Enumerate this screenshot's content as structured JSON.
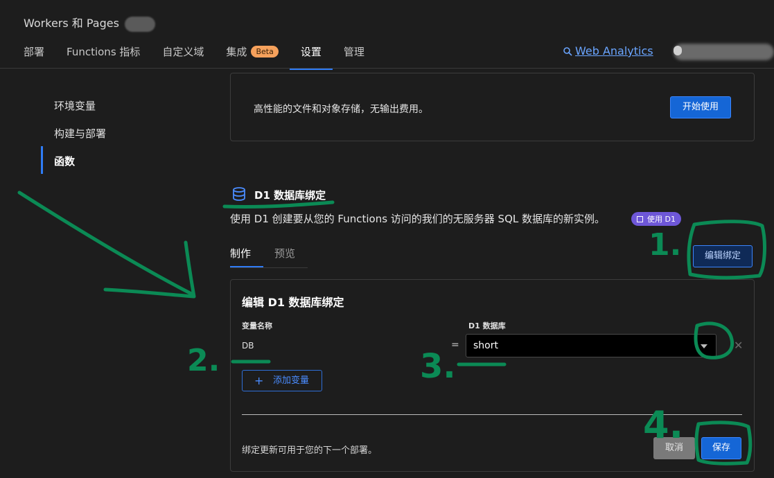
{
  "header": {
    "app_title": "Workers 和 Pages",
    "tabs": [
      {
        "label": "部署"
      },
      {
        "label": "Functions 指标"
      },
      {
        "label": "自定义域"
      },
      {
        "label": "集成",
        "badge": "Beta"
      },
      {
        "label": "设置",
        "active": true
      },
      {
        "label": "管理"
      }
    ],
    "analytics_link": "Web Analytics"
  },
  "sidebar": {
    "items": [
      {
        "label": "环境变量"
      },
      {
        "label": "构建与部署"
      },
      {
        "label": "函数",
        "active": true
      }
    ]
  },
  "storage_card": {
    "text": "高性能的文件和对象存储，无输出费用。",
    "button": "开始使用"
  },
  "d1": {
    "title": "D1 数据库绑定",
    "description": "使用 D1 创建要从您的 Functions 访问的我们的无服务器 SQL 数据库的新实例。",
    "badge": "使用 D1",
    "subtabs": [
      "制作",
      "预览"
    ],
    "edit_button": "编辑绑定"
  },
  "edit_card": {
    "title": "编辑 D1 数据库绑定",
    "col_var": "变量名称",
    "col_db": "D1 数据库",
    "var_value": "DB",
    "equals": "=",
    "db_value": "short",
    "clear": "✕",
    "add_button": "添加变量",
    "add_plus": "+",
    "footnote": "绑定更新可用于您的下一个部署。",
    "cancel": "取消",
    "save": "保存"
  },
  "annotations": {
    "labels": [
      "1.",
      "2.",
      "3.",
      "4."
    ],
    "color": "#0b8a55"
  },
  "colors": {
    "background": "#1d1d1d",
    "accent": "#2f7cf6",
    "primary_button": "#1566d6",
    "beta_badge": "#f6a15c",
    "d1_badge": "#6e57d8"
  }
}
